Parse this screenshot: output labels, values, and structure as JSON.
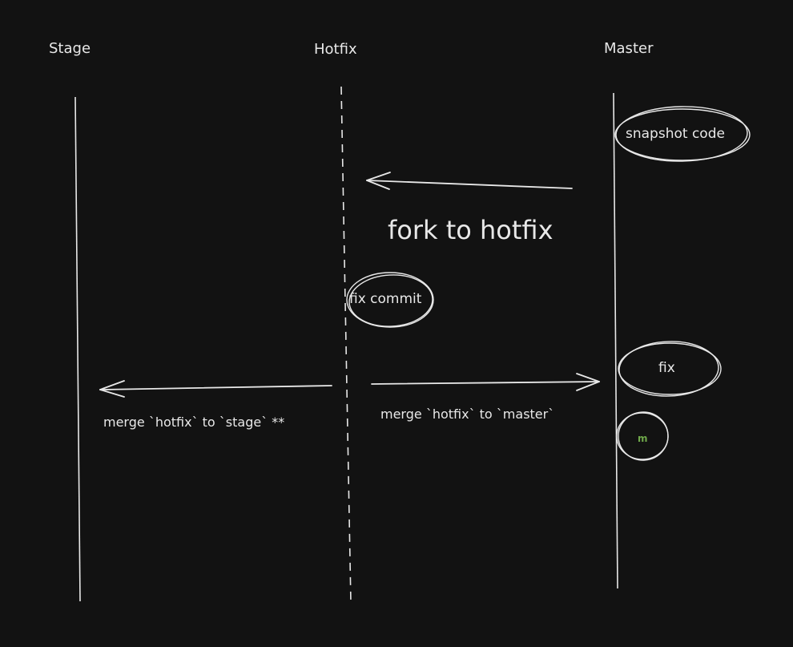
{
  "lanes": {
    "stage": "Stage",
    "hotfix": "Hotfix",
    "master": "Master"
  },
  "nodes": {
    "snapshot": "snapshot code",
    "fix_commit": "fix commit",
    "fix": "fix",
    "m": "m"
  },
  "edges": {
    "fork": "fork to hotfix",
    "merge_stage": "merge `hotfix` to `stage` **",
    "merge_master": "merge `hotfix` to `master`"
  },
  "colors": {
    "background": "#121212",
    "stroke": "#e8e8e8",
    "accent_green": "#6fa84a"
  }
}
